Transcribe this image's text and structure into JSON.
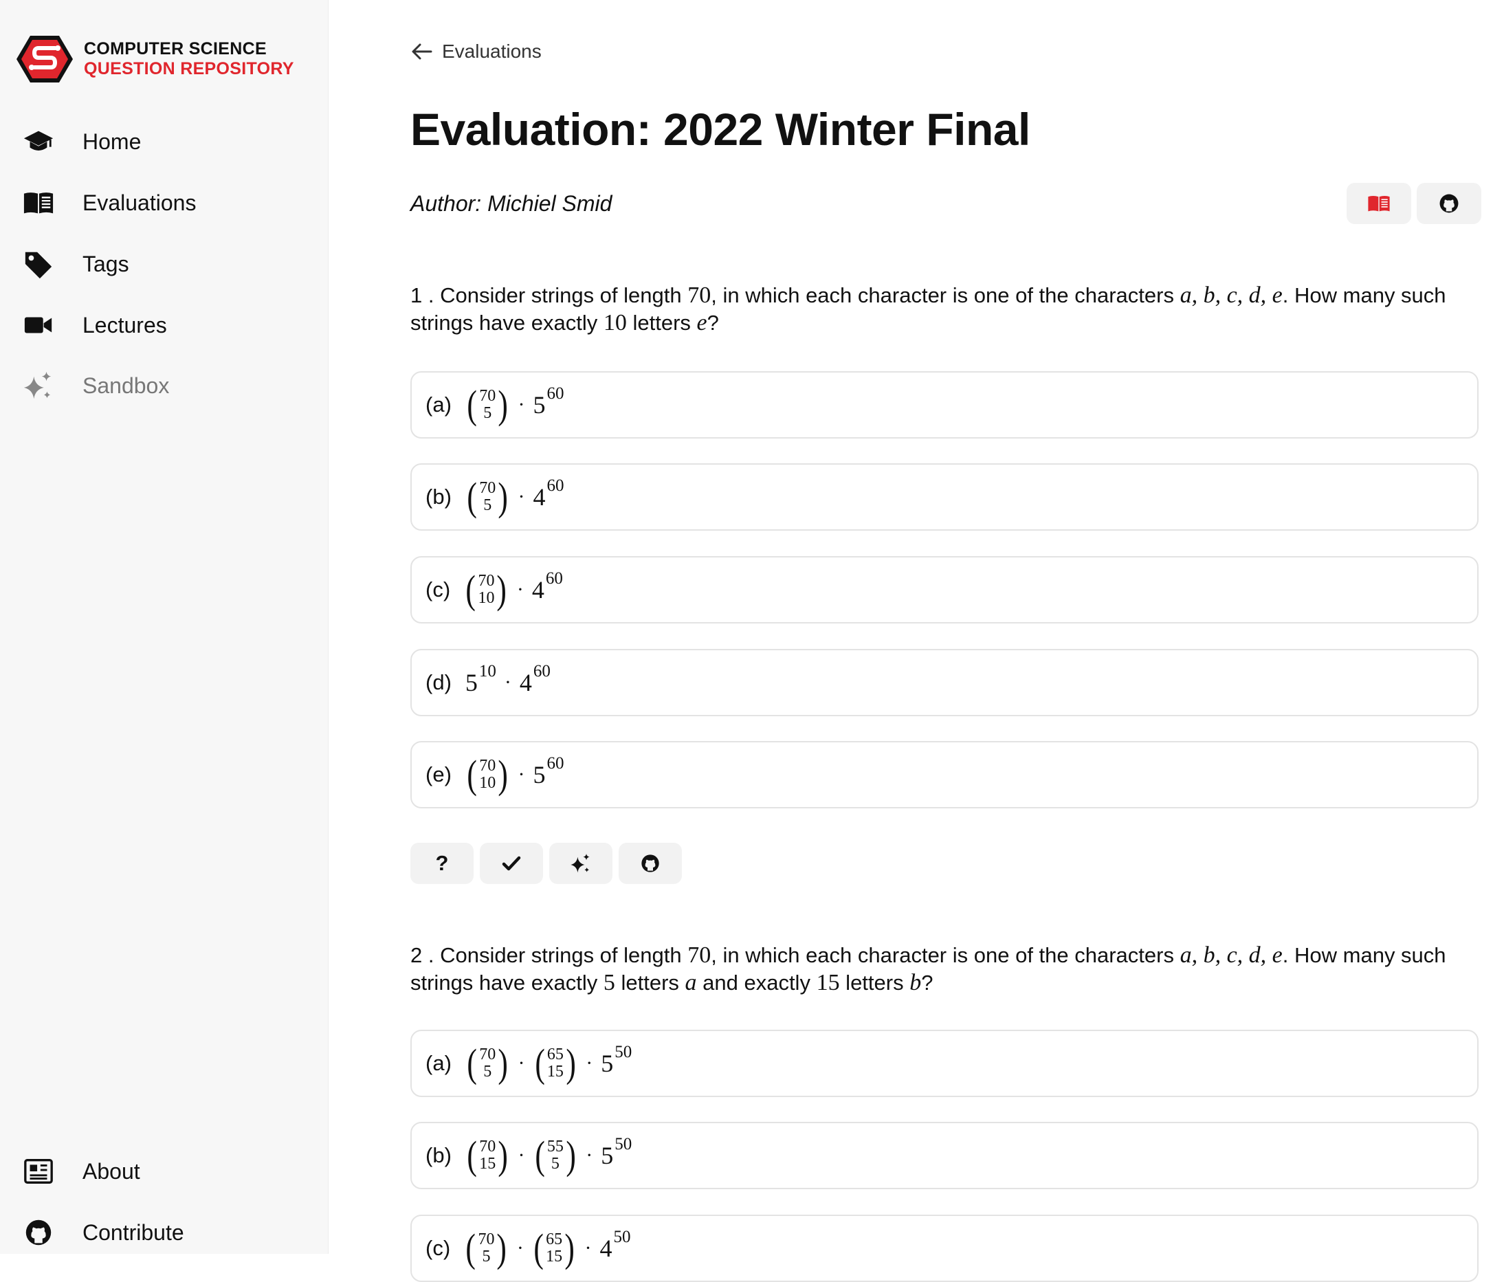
{
  "logo": {
    "line1": "COMPUTER SCIENCE",
    "line2": "QUESTION REPOSITORY"
  },
  "nav": [
    {
      "label": "Home",
      "icon": "graduation-cap-icon"
    },
    {
      "label": "Evaluations",
      "icon": "open-book-icon"
    },
    {
      "label": "Tags",
      "icon": "tag-icon"
    },
    {
      "label": "Lectures",
      "icon": "video-camera-icon"
    },
    {
      "label": "Sandbox",
      "icon": "sparkles-icon"
    }
  ],
  "nav_bottom": [
    {
      "label": "About",
      "icon": "newspaper-icon"
    },
    {
      "label": "Contribute",
      "icon": "github-icon"
    }
  ],
  "back_link": "Evaluations",
  "title": "Evaluation: 2022 Winter Final",
  "author": "Author: Michiel Smid",
  "colors": {
    "brand_red": "#e0262d",
    "sidebar_bg": "#f7f7f7",
    "button_bg": "#f2f2f2",
    "option_border": "#e3e3e3"
  },
  "questions": [
    {
      "number": "1",
      "parts": [
        {
          "t": "text",
          "v": " . Consider strings of length "
        },
        {
          "t": "math",
          "v": "70"
        },
        {
          "t": "text",
          "v": ", in which each character is one of the characters "
        },
        {
          "t": "mathi",
          "v": "a, b, c, d, e"
        },
        {
          "t": "text",
          "v": ". How many such strings have exactly "
        },
        {
          "t": "math",
          "v": "10"
        },
        {
          "t": "text",
          "v": " letters "
        },
        {
          "t": "mathi",
          "v": "e"
        },
        {
          "t": "text",
          "v": "?"
        }
      ],
      "options": [
        {
          "label": "(a)",
          "expr": [
            {
              "t": "binom",
              "n": "70",
              "k": "5"
            },
            {
              "t": "dot"
            },
            {
              "t": "pow",
              "b": "5",
              "e": "60"
            }
          ]
        },
        {
          "label": "(b)",
          "expr": [
            {
              "t": "binom",
              "n": "70",
              "k": "5"
            },
            {
              "t": "dot"
            },
            {
              "t": "pow",
              "b": "4",
              "e": "60"
            }
          ]
        },
        {
          "label": "(c)",
          "expr": [
            {
              "t": "binom",
              "n": "70",
              "k": "10"
            },
            {
              "t": "dot"
            },
            {
              "t": "pow",
              "b": "4",
              "e": "60"
            }
          ]
        },
        {
          "label": "(d)",
          "expr": [
            {
              "t": "pow",
              "b": "5",
              "e": "10"
            },
            {
              "t": "dot"
            },
            {
              "t": "pow",
              "b": "4",
              "e": "60"
            }
          ]
        },
        {
          "label": "(e)",
          "expr": [
            {
              "t": "binom",
              "n": "70",
              "k": "10"
            },
            {
              "t": "dot"
            },
            {
              "t": "pow",
              "b": "5",
              "e": "60"
            }
          ]
        }
      ],
      "actions": [
        {
          "label": "?",
          "icon": "question-icon"
        },
        {
          "label": "",
          "icon": "check-icon"
        },
        {
          "label": "",
          "icon": "sparkles-icon"
        },
        {
          "label": "",
          "icon": "github-icon"
        }
      ]
    },
    {
      "number": "2",
      "parts": [
        {
          "t": "text",
          "v": " . Consider strings of length "
        },
        {
          "t": "math",
          "v": "70"
        },
        {
          "t": "text",
          "v": ", in which each character is one of the characters "
        },
        {
          "t": "mathi",
          "v": "a, b, c, d, e"
        },
        {
          "t": "text",
          "v": ". How many such strings have exactly "
        },
        {
          "t": "math",
          "v": "5"
        },
        {
          "t": "text",
          "v": " letters "
        },
        {
          "t": "mathi",
          "v": "a"
        },
        {
          "t": "text",
          "v": " and exactly "
        },
        {
          "t": "math",
          "v": "15"
        },
        {
          "t": "text",
          "v": " letters "
        },
        {
          "t": "mathi",
          "v": "b"
        },
        {
          "t": "text",
          "v": "?"
        }
      ],
      "options": [
        {
          "label": "(a)",
          "expr": [
            {
              "t": "binom",
              "n": "70",
              "k": "5"
            },
            {
              "t": "dot"
            },
            {
              "t": "binom",
              "n": "65",
              "k": "15"
            },
            {
              "t": "dot"
            },
            {
              "t": "pow",
              "b": "5",
              "e": "50"
            }
          ]
        },
        {
          "label": "(b)",
          "expr": [
            {
              "t": "binom",
              "n": "70",
              "k": "15"
            },
            {
              "t": "dot"
            },
            {
              "t": "binom",
              "n": "55",
              "k": "5"
            },
            {
              "t": "dot"
            },
            {
              "t": "pow",
              "b": "5",
              "e": "50"
            }
          ]
        },
        {
          "label": "(c)",
          "expr": [
            {
              "t": "binom",
              "n": "70",
              "k": "5"
            },
            {
              "t": "dot"
            },
            {
              "t": "binom",
              "n": "65",
              "k": "15"
            },
            {
              "t": "dot"
            },
            {
              "t": "pow",
              "b": "4",
              "e": "50"
            }
          ]
        }
      ]
    }
  ]
}
